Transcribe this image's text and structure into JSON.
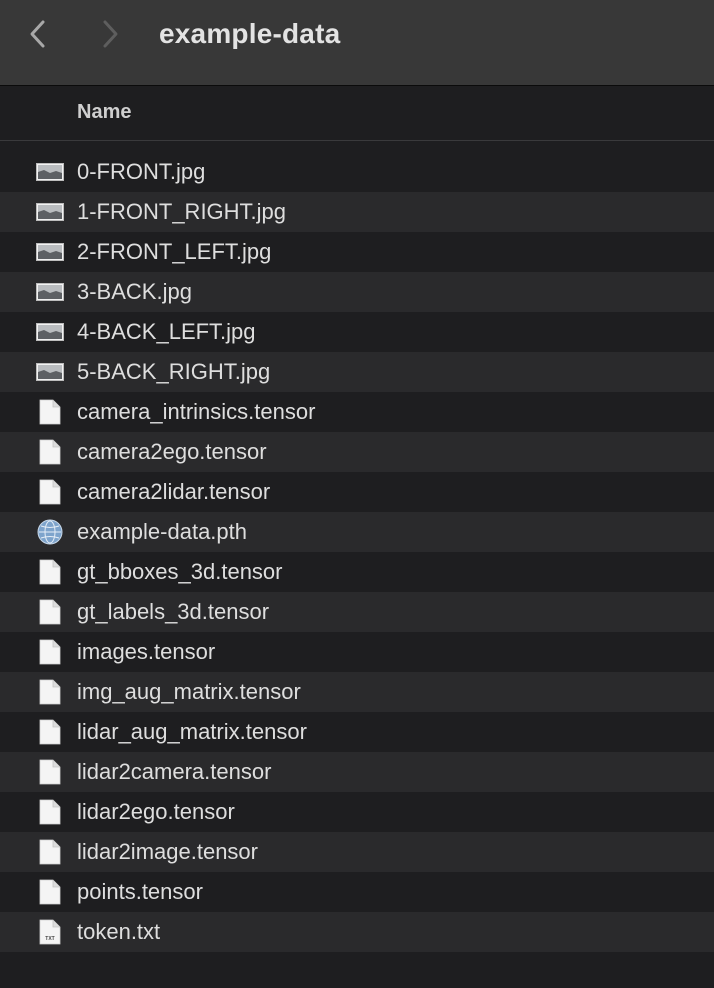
{
  "window": {
    "title": "example-data"
  },
  "toolbar": {
    "back_icon": "chevron-left-icon",
    "forward_icon": "chevron-right-icon"
  },
  "list_header": {
    "name_label": "Name"
  },
  "files": [
    {
      "name": "0-FRONT.jpg",
      "icon": "image-thumbnail-icon"
    },
    {
      "name": "1-FRONT_RIGHT.jpg",
      "icon": "image-thumbnail-icon"
    },
    {
      "name": "2-FRONT_LEFT.jpg",
      "icon": "image-thumbnail-icon"
    },
    {
      "name": "3-BACK.jpg",
      "icon": "image-thumbnail-icon"
    },
    {
      "name": "4-BACK_LEFT.jpg",
      "icon": "image-thumbnail-icon"
    },
    {
      "name": "5-BACK_RIGHT.jpg",
      "icon": "image-thumbnail-icon"
    },
    {
      "name": "camera_intrinsics.tensor",
      "icon": "document-icon"
    },
    {
      "name": "camera2ego.tensor",
      "icon": "document-icon"
    },
    {
      "name": "camera2lidar.tensor",
      "icon": "document-icon"
    },
    {
      "name": "example-data.pth",
      "icon": "globe-icon"
    },
    {
      "name": "gt_bboxes_3d.tensor",
      "icon": "document-icon"
    },
    {
      "name": "gt_labels_3d.tensor",
      "icon": "document-icon"
    },
    {
      "name": "images.tensor",
      "icon": "document-icon"
    },
    {
      "name": "img_aug_matrix.tensor",
      "icon": "document-icon"
    },
    {
      "name": "lidar_aug_matrix.tensor",
      "icon": "document-icon"
    },
    {
      "name": "lidar2camera.tensor",
      "icon": "document-icon"
    },
    {
      "name": "lidar2ego.tensor",
      "icon": "document-icon"
    },
    {
      "name": "lidar2image.tensor",
      "icon": "document-icon"
    },
    {
      "name": "points.tensor",
      "icon": "document-icon"
    },
    {
      "name": "token.txt",
      "icon": "text-file-icon",
      "icon_text": "TXT"
    }
  ],
  "colors": {
    "toolbar_bg": "#383838",
    "list_bg": "#1e1e20",
    "alt_row_bg": "#2a2a2c",
    "text": "#dedede"
  }
}
